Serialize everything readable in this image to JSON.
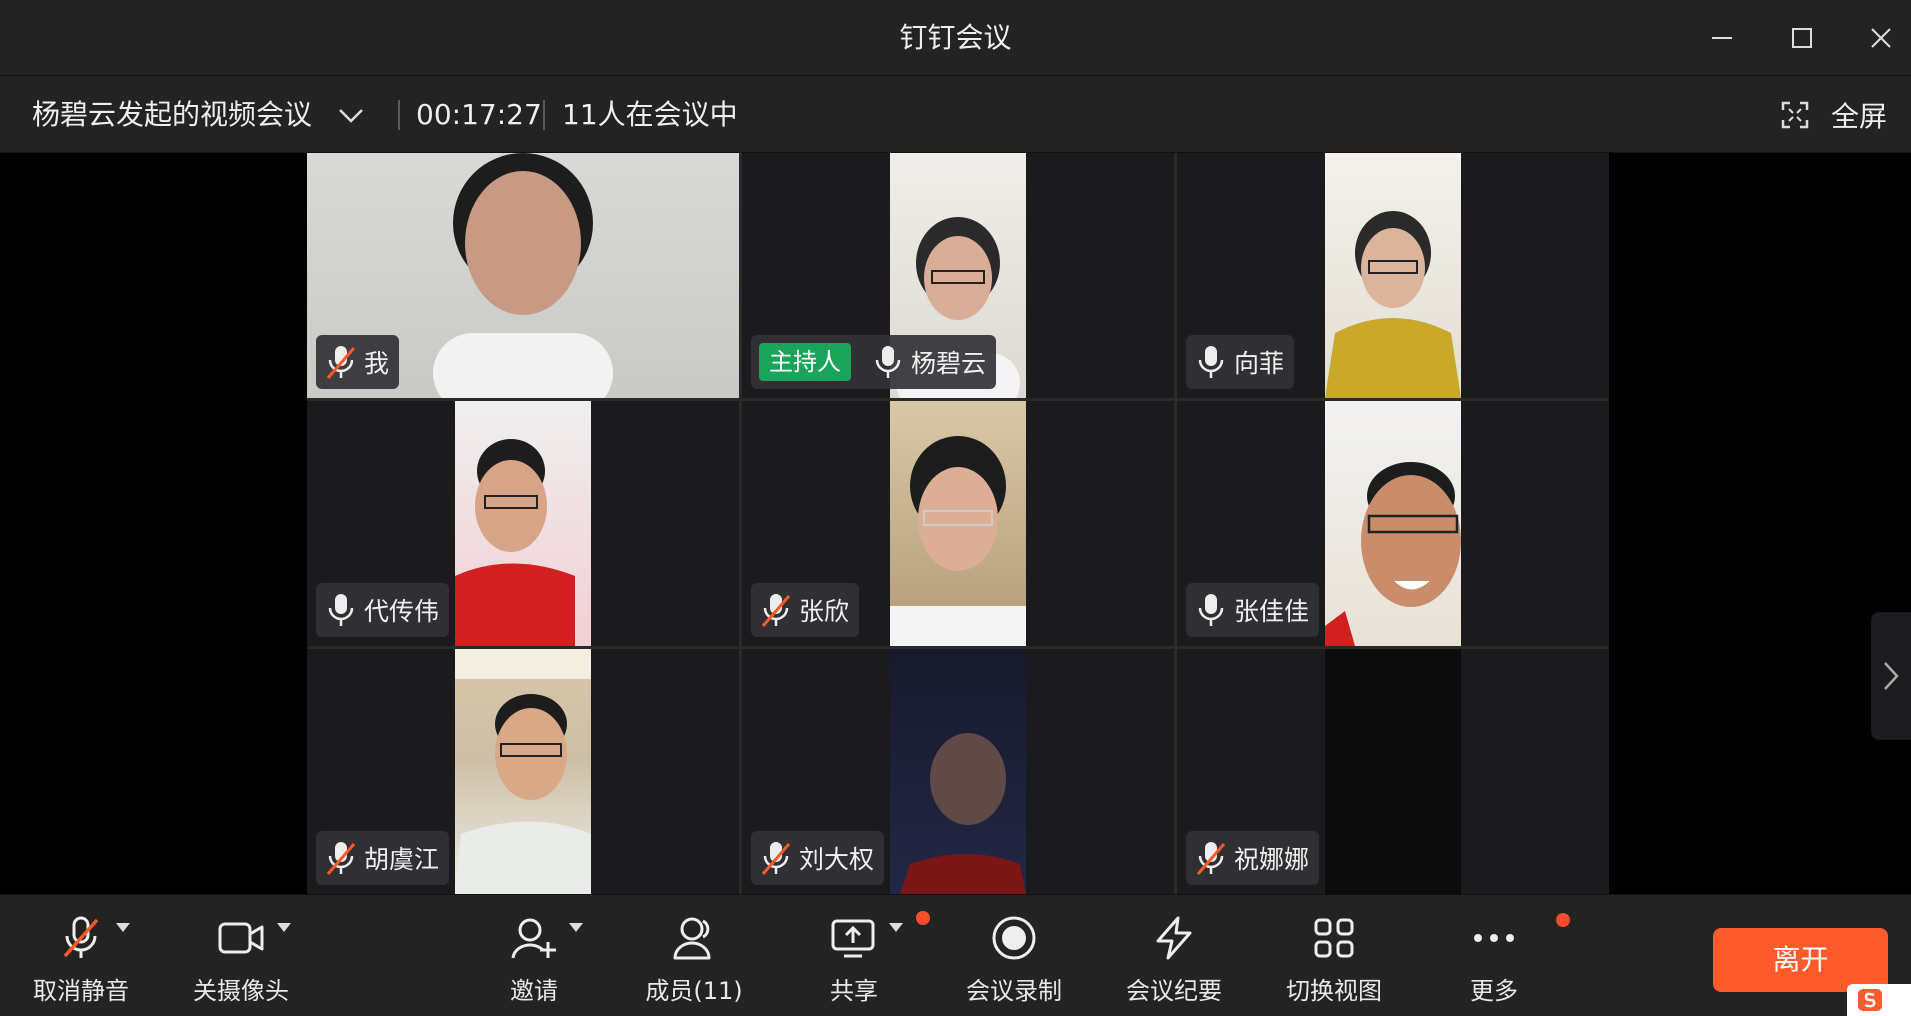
{
  "window": {
    "title": "钉钉会议"
  },
  "infobar": {
    "meeting_name": "杨碧云发起的视频会议",
    "elapsed": "00:17:27",
    "participant_count": "11人在会议中",
    "fullscreen_label": "全屏"
  },
  "tiles": [
    {
      "name": "我",
      "mic": "muted",
      "host": false
    },
    {
      "name": "杨碧云",
      "mic": "on",
      "host": true,
      "host_label": "主持人"
    },
    {
      "name": "向菲",
      "mic": "on",
      "host": false
    },
    {
      "name": "代传伟",
      "mic": "on",
      "host": false
    },
    {
      "name": "张欣",
      "mic": "muted",
      "host": false
    },
    {
      "name": "张佳佳",
      "mic": "on",
      "host": false
    },
    {
      "name": "胡虞江",
      "mic": "muted",
      "host": false
    },
    {
      "name": "刘大权",
      "mic": "muted",
      "host": false
    },
    {
      "name": "祝娜娜",
      "mic": "muted",
      "host": false
    }
  ],
  "toolbar": {
    "unmute": "取消静音",
    "camera_off": "关摄像头",
    "invite": "邀请",
    "members": "成员(11)",
    "share": "共享",
    "record": "会议录制",
    "minutes": "会议纪要",
    "switch_view": "切换视图",
    "more": "更多",
    "leave": "离开"
  },
  "colors": {
    "leave": "#ff5a2b",
    "host_badge": "#1aa35a",
    "notification_dot": "#ff4d2e",
    "mute_slash": "#ff5a2b"
  }
}
